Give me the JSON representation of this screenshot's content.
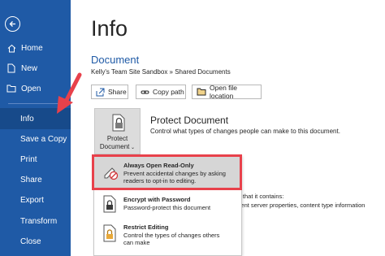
{
  "sidebar": {
    "items": [
      {
        "label": "Home",
        "icon": "home-icon"
      },
      {
        "label": "New",
        "icon": "new-document-icon"
      },
      {
        "label": "Open",
        "icon": "folder-open-icon"
      },
      {
        "label": "Info"
      },
      {
        "label": "Save a Copy"
      },
      {
        "label": "Print"
      },
      {
        "label": "Share"
      },
      {
        "label": "Export"
      },
      {
        "label": "Transform"
      },
      {
        "label": "Close"
      }
    ],
    "active": "Info",
    "background": "#1f5aa6"
  },
  "main": {
    "title": "Info",
    "document_name": "Document",
    "document_path": "Kelly's Team Site Sandbox » Shared Documents",
    "buttons": {
      "share": "Share",
      "copy_path": "Copy path",
      "open_location": "Open file location"
    },
    "protect": {
      "button_line1": "Protect",
      "button_line2": "Document",
      "heading": "Protect Document",
      "description": "Control what types of changes people can make to this document."
    },
    "partial_texts": {
      "line1": "are that it contains:",
      "line2": "ument server properties, content type information"
    }
  },
  "menu": {
    "items": [
      {
        "title": "Always Open Read-Only",
        "desc1": "Prevent accidental changes by asking",
        "desc2": "readers to opt-in to editing.",
        "icon": "pencil-no-edit-icon"
      },
      {
        "title": "Encrypt with Password",
        "desc1": "Password-protect this document",
        "desc2": "",
        "icon": "encrypt-lock-icon"
      },
      {
        "title": "Restrict Editing",
        "desc1": "Control the types of changes others",
        "desc2": "can make",
        "icon": "restrict-editing-lock-icon"
      }
    ]
  },
  "colors": {
    "accent": "#1f5aa6",
    "highlight": "#e8414b"
  }
}
